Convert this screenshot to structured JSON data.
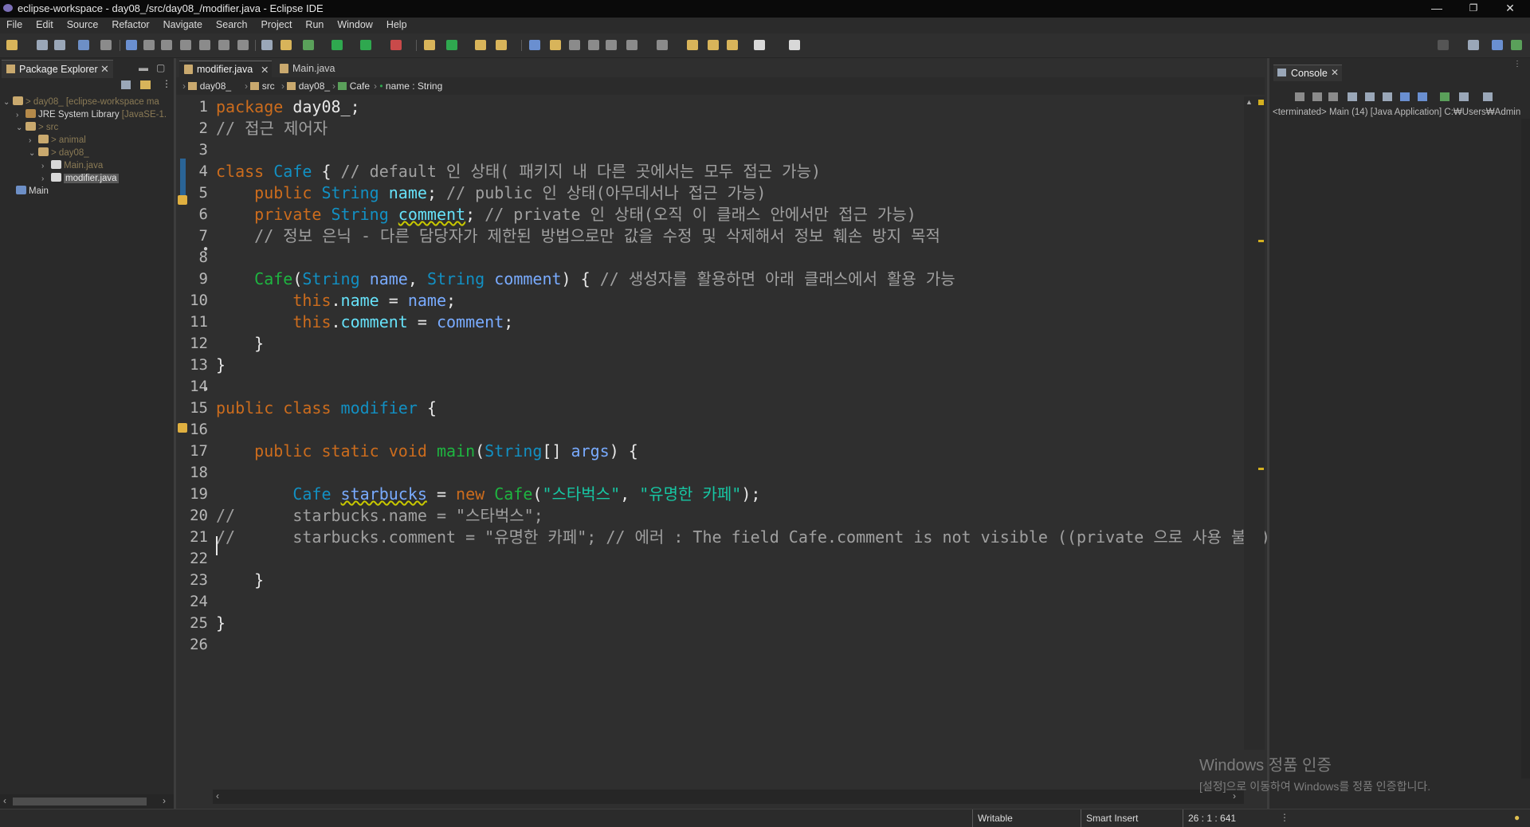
{
  "window": {
    "title": "eclipse-workspace - day08_/src/day08_/modifier.java - Eclipse IDE",
    "controls": [
      "—",
      "❐",
      "✕"
    ]
  },
  "menu": [
    "File",
    "Edit",
    "Source",
    "Refactor",
    "Navigate",
    "Search",
    "Project",
    "Run",
    "Window",
    "Help"
  ],
  "package_explorer": {
    "title": "Package Explorer",
    "tree": [
      {
        "label": "day08_",
        "suffix": " [eclipse-workspace ma",
        "icon": "project-icon"
      },
      {
        "label": "JRE System Library",
        "suffix": " [JavaSE-1.",
        "icon": "library-icon"
      },
      {
        "label": "src",
        "icon": "source-folder-icon"
      },
      {
        "label": "animal",
        "icon": "package-icon"
      },
      {
        "label": "day08_",
        "icon": "package-icon"
      },
      {
        "label": "Main.java",
        "icon": "java-file-icon"
      },
      {
        "label": "modifier.java",
        "icon": "java-file-icon"
      },
      {
        "label": "Main",
        "icon": "folder-icon"
      }
    ]
  },
  "editor": {
    "tabs": [
      {
        "label": "modifier.java",
        "active": true
      },
      {
        "label": "Main.java",
        "active": false
      }
    ],
    "breadcrumb": [
      "day08_",
      "src",
      "day08_",
      "Cafe",
      "name : String"
    ],
    "lines": [
      {
        "n": "1",
        "segs": [
          [
            "kw",
            "package "
          ],
          [
            "pk",
            "day08_;"
          ]
        ]
      },
      {
        "n": "2",
        "segs": [
          [
            "cm",
            "// 접근 제어자"
          ]
        ]
      },
      {
        "n": "3",
        "segs": []
      },
      {
        "n": "4",
        "segs": [
          [
            "kw",
            "class "
          ],
          [
            "ty",
            "Cafe"
          ],
          [
            "pl",
            " { "
          ],
          [
            "cm",
            "// default 인 상태( 패키지 내 다른 곳에서는 모두 접근 가능)"
          ]
        ]
      },
      {
        "n": "5",
        "segs": [
          [
            "pl",
            "    "
          ],
          [
            "kw",
            "public "
          ],
          [
            "ty",
            "String "
          ],
          [
            "fld",
            "name"
          ],
          [
            "pl",
            "; "
          ],
          [
            "cm",
            "// public 인 상태(아무데서나 접근 가능)"
          ]
        ]
      },
      {
        "n": "6",
        "segs": [
          [
            "pl",
            "    "
          ],
          [
            "kw",
            "private "
          ],
          [
            "ty",
            "String "
          ],
          [
            "fld ul",
            "comment"
          ],
          [
            "pl",
            "; "
          ],
          [
            "cm",
            "// private 인 상태(오직 이 클래스 안에서만 접근 가능)"
          ]
        ]
      },
      {
        "n": "7",
        "segs": [
          [
            "pl",
            "    "
          ],
          [
            "cm",
            "// 정보 은닉 - 다른 담당자가 제한된 방법으로만 값을 수정 및 삭제해서 정보 훼손 방지 목적"
          ]
        ]
      },
      {
        "n": "8",
        "segs": []
      },
      {
        "n": "9",
        "segs": [
          [
            "pl",
            "    "
          ],
          [
            "mt",
            "Cafe"
          ],
          [
            "pl",
            "("
          ],
          [
            "ty",
            "String "
          ],
          [
            "lv",
            "name"
          ],
          [
            "pl",
            ", "
          ],
          [
            "ty",
            "String "
          ],
          [
            "lv",
            "comment"
          ],
          [
            "pl",
            ") { "
          ],
          [
            "cm",
            "// 생성자를 활용하면 아래 클래스에서 활용 가능"
          ]
        ]
      },
      {
        "n": "10",
        "segs": [
          [
            "pl",
            "        "
          ],
          [
            "kw",
            "this"
          ],
          [
            "pl",
            "."
          ],
          [
            "fld",
            "name"
          ],
          [
            "pl",
            " = "
          ],
          [
            "lv",
            "name"
          ],
          [
            "pl",
            ";"
          ]
        ]
      },
      {
        "n": "11",
        "segs": [
          [
            "pl",
            "        "
          ],
          [
            "kw",
            "this"
          ],
          [
            "pl",
            "."
          ],
          [
            "fld",
            "comment"
          ],
          [
            "pl",
            " = "
          ],
          [
            "lv",
            "comment"
          ],
          [
            "pl",
            ";"
          ]
        ]
      },
      {
        "n": "12",
        "segs": [
          [
            "pl",
            "    }"
          ]
        ]
      },
      {
        "n": "13",
        "segs": [
          [
            "pl",
            "}"
          ]
        ]
      },
      {
        "n": "14",
        "segs": []
      },
      {
        "n": "15",
        "segs": [
          [
            "kw",
            "public class "
          ],
          [
            "ty",
            "modifier"
          ],
          [
            "pl",
            " {"
          ]
        ]
      },
      {
        "n": "16",
        "segs": []
      },
      {
        "n": "17",
        "segs": [
          [
            "pl",
            "    "
          ],
          [
            "kw",
            "public static void "
          ],
          [
            "mt",
            "main"
          ],
          [
            "pl",
            "("
          ],
          [
            "ty",
            "String"
          ],
          [
            "pl",
            "[] "
          ],
          [
            "lv",
            "args"
          ],
          [
            "pl",
            ") {"
          ]
        ]
      },
      {
        "n": "18",
        "segs": []
      },
      {
        "n": "19",
        "segs": [
          [
            "pl",
            "        "
          ],
          [
            "ty",
            "Cafe "
          ],
          [
            "lv ul",
            "starbucks"
          ],
          [
            "pl",
            " = "
          ],
          [
            "kw",
            "new "
          ],
          [
            "mt",
            "Cafe"
          ],
          [
            "pl",
            "("
          ],
          [
            "st",
            "\"스타벅스\""
          ],
          [
            "pl",
            ", "
          ],
          [
            "st",
            "\"유명한 카페\""
          ],
          [
            "pl",
            ");"
          ]
        ]
      },
      {
        "n": "20",
        "segs": [
          [
            "cm",
            "//      starbucks.name = \"스타벅스\";"
          ]
        ]
      },
      {
        "n": "21",
        "segs": [
          [
            "cm",
            "//      starbucks.comment = \"유명한 카페\"; // 에러 : The field Cafe.comment is not visible ((private 으로 사용 불가)"
          ]
        ]
      },
      {
        "n": "22",
        "segs": []
      },
      {
        "n": "23",
        "segs": [
          [
            "pl",
            "    }"
          ]
        ]
      },
      {
        "n": "24",
        "segs": []
      },
      {
        "n": "25",
        "segs": [
          [
            "pl",
            "}"
          ]
        ]
      },
      {
        "n": "26",
        "segs": []
      }
    ]
  },
  "console": {
    "title": "Console",
    "status": "<terminated> Main (14) [Java Application] C:₩Users₩Admin"
  },
  "watermark": {
    "line1": "Windows 정품 인증",
    "line2": "[설정]으로 이동하여 Windows를 정품 인증합니다."
  },
  "statusbar": {
    "writable": "Writable",
    "insert_mode": "Smart Insert",
    "position": "26 : 1 : 641"
  }
}
